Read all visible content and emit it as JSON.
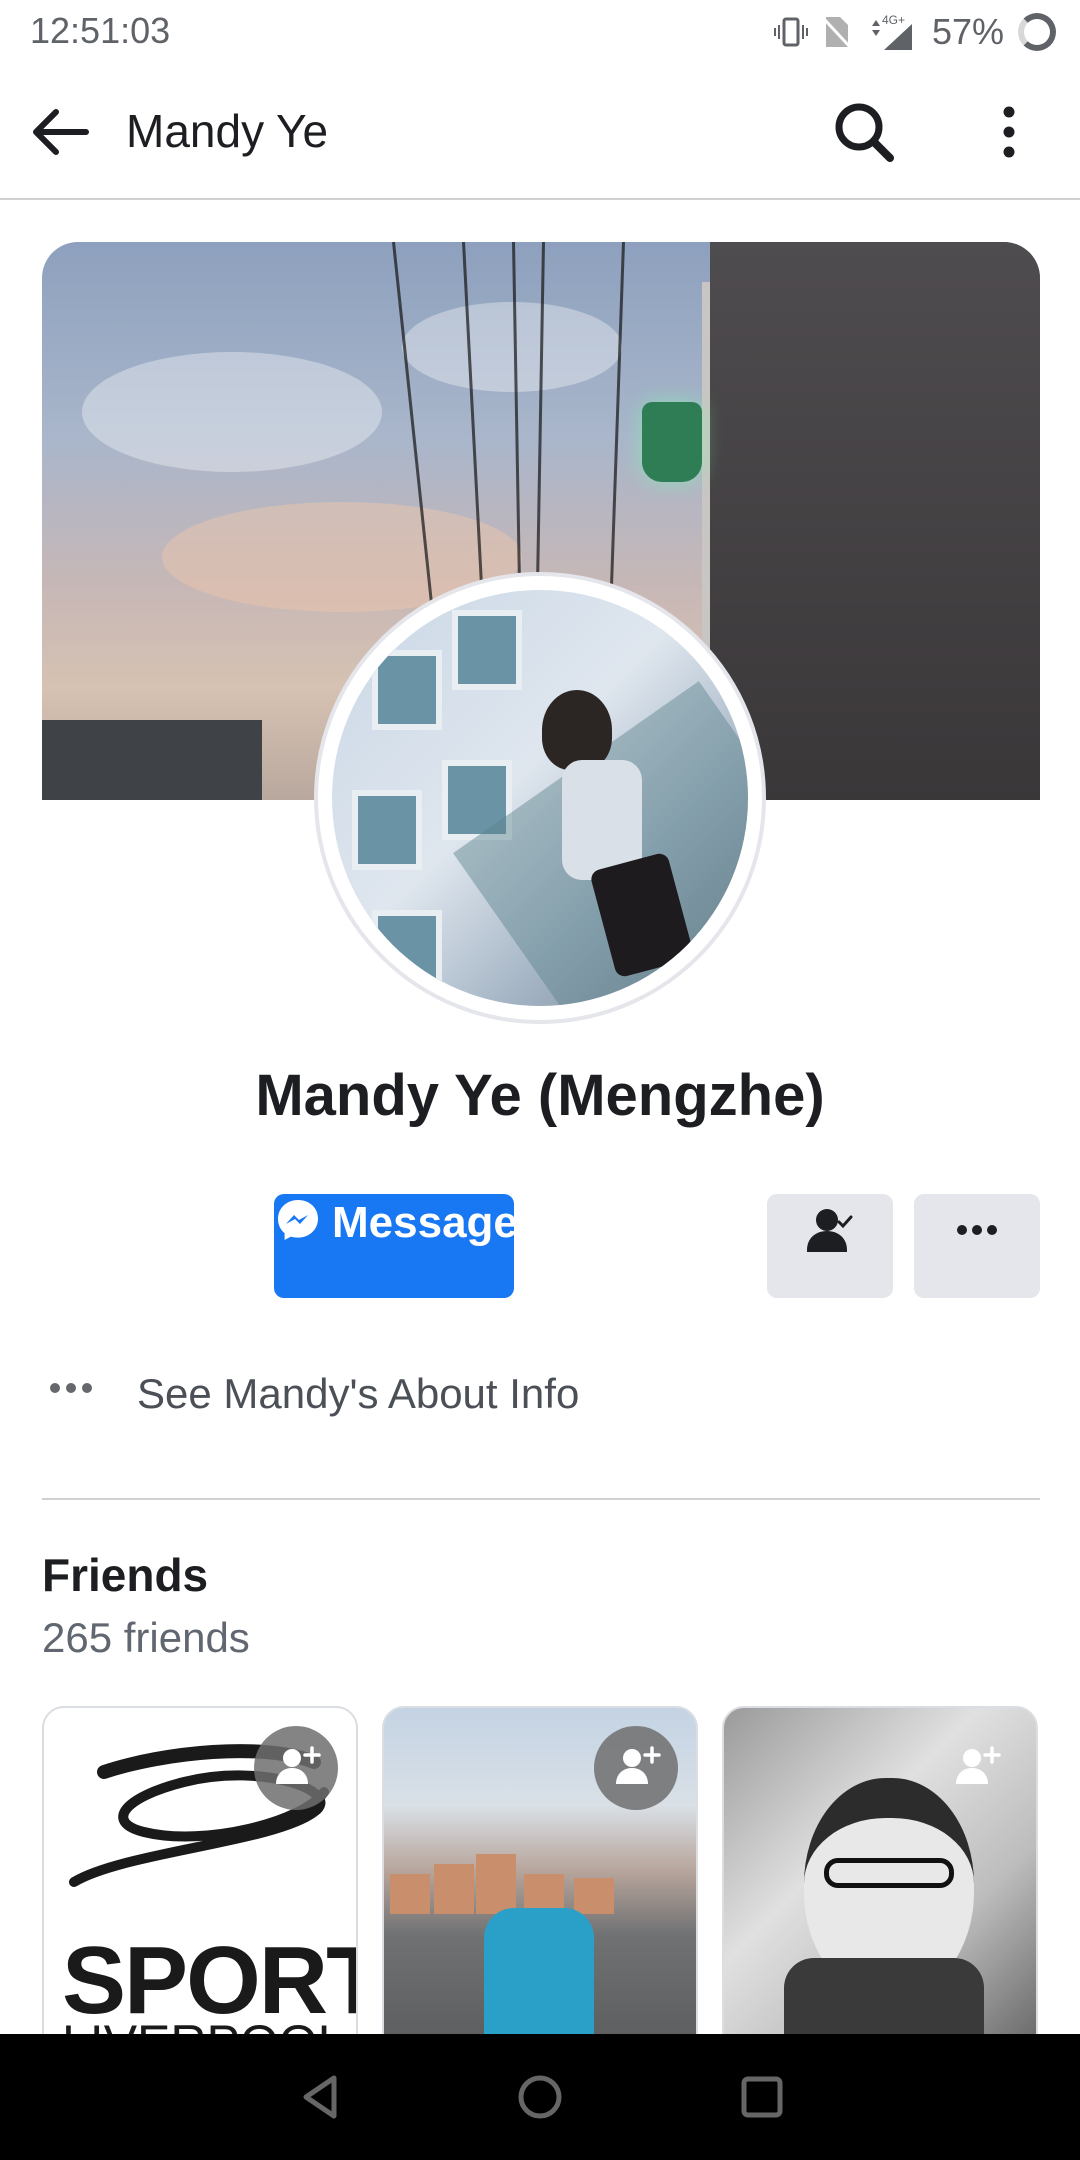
{
  "status_bar": {
    "time": "12:51:03",
    "network": "4G+",
    "battery": "57%"
  },
  "app_bar": {
    "title": "Mandy Ye",
    "icons": [
      "arrow-back-icon",
      "search-icon",
      "more-vertical-icon"
    ]
  },
  "profile": {
    "name": "Mandy Ye (Mengzhe)",
    "message_label": "Message",
    "about_text": "See Mandy's About Info"
  },
  "friends": {
    "title": "Friends",
    "count": "265 friends",
    "card1_text": "SPORT",
    "card1_subtext": "LIVERPOOL"
  },
  "colors": {
    "accent": "#1877f2",
    "button_gray": "#e4e6eb",
    "text_primary": "#1c1e21",
    "text_secondary": "#606770"
  }
}
